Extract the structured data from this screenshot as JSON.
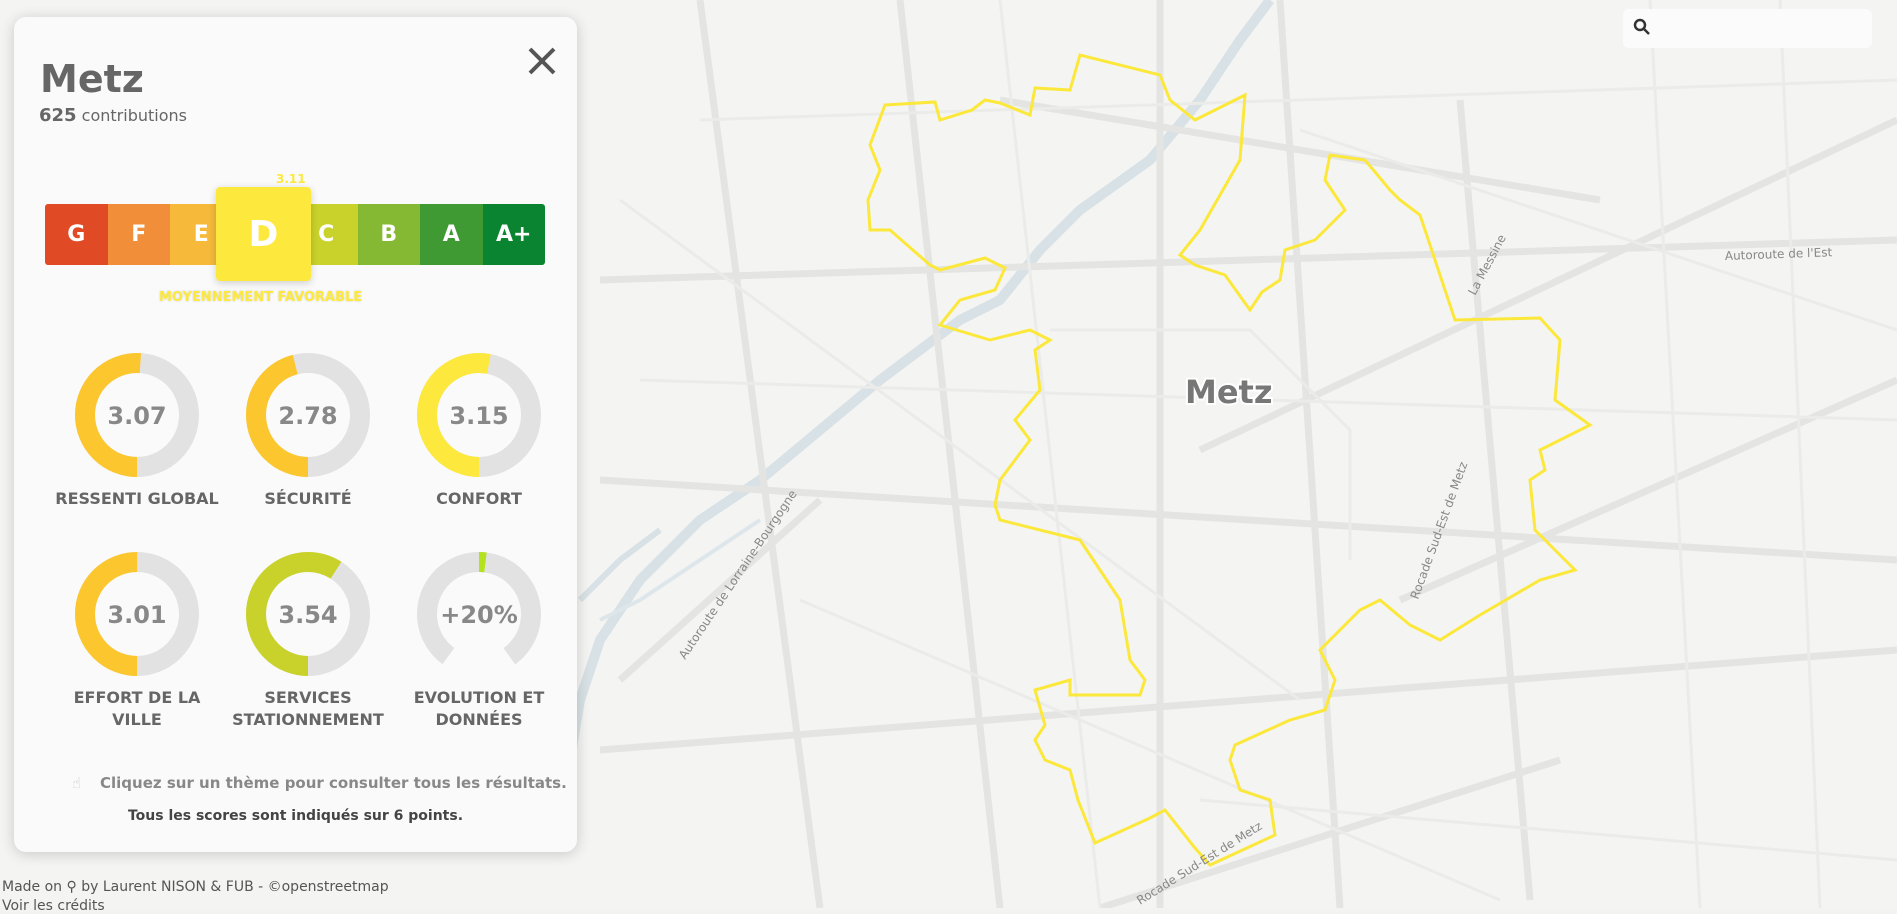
{
  "panel": {
    "city": "Metz",
    "contributions_count": "625",
    "contributions_label": "contributions",
    "close_icon": "close-icon",
    "scale": {
      "grades": [
        {
          "label": "G",
          "color": "#e04a25"
        },
        {
          "label": "F",
          "color": "#f08e3a"
        },
        {
          "label": "E",
          "color": "#f7b93a"
        },
        {
          "label": "D",
          "color": "#fde93d"
        },
        {
          "label": "C",
          "color": "#c9d22a"
        },
        {
          "label": "B",
          "color": "#86b933"
        },
        {
          "label": "A",
          "color": "#3f9a33"
        },
        {
          "label": "A+",
          "color": "#0b8431"
        }
      ],
      "active_grade": "D",
      "active_score": "3.11",
      "active_label": "MOYENNEMENT FAVORABLE"
    },
    "metrics": [
      {
        "value": "3.07",
        "label": "RESSENTI GLOBAL",
        "fraction": 0.51,
        "color": "#fcc72e"
      },
      {
        "value": "2.78",
        "label": "SÉCURITÉ",
        "fraction": 0.46,
        "color": "#fcc72e"
      },
      {
        "value": "3.15",
        "label": "CONFORT",
        "fraction": 0.53,
        "color": "#fde93d"
      },
      {
        "value": "3.01",
        "label": "EFFORT DE LA VILLE",
        "fraction": 0.5,
        "color": "#fcc72e"
      },
      {
        "value": "3.54",
        "label": "SERVICES STATIONNEMENT",
        "fraction": 0.59,
        "color": "#c9d22a"
      },
      {
        "value": "+20%",
        "label": "EVOLUTION ET DONNÉES",
        "fraction": 0.2,
        "color": "#b4e21f"
      }
    ],
    "hint": "Cliquez sur un thème pour consulter tous les résultats.",
    "note": "Tous les scores sont indiqués sur 6 points."
  },
  "search": {
    "icon": "search-icon",
    "placeholder": ""
  },
  "map": {
    "city_label": "Metz",
    "roads": [
      "Autoroute de l'Est",
      "La Messine",
      "Rocade Sud-Est de Metz",
      "Rocade Sud-Est de Metz",
      "Autoroute de Lorraine-Bourgogne"
    ]
  },
  "footer": {
    "credits_prefix": "Made on",
    "credits_suffix": "by Laurent NISON & FUB - ©openstreetmap",
    "link": "Voir les crédits"
  }
}
